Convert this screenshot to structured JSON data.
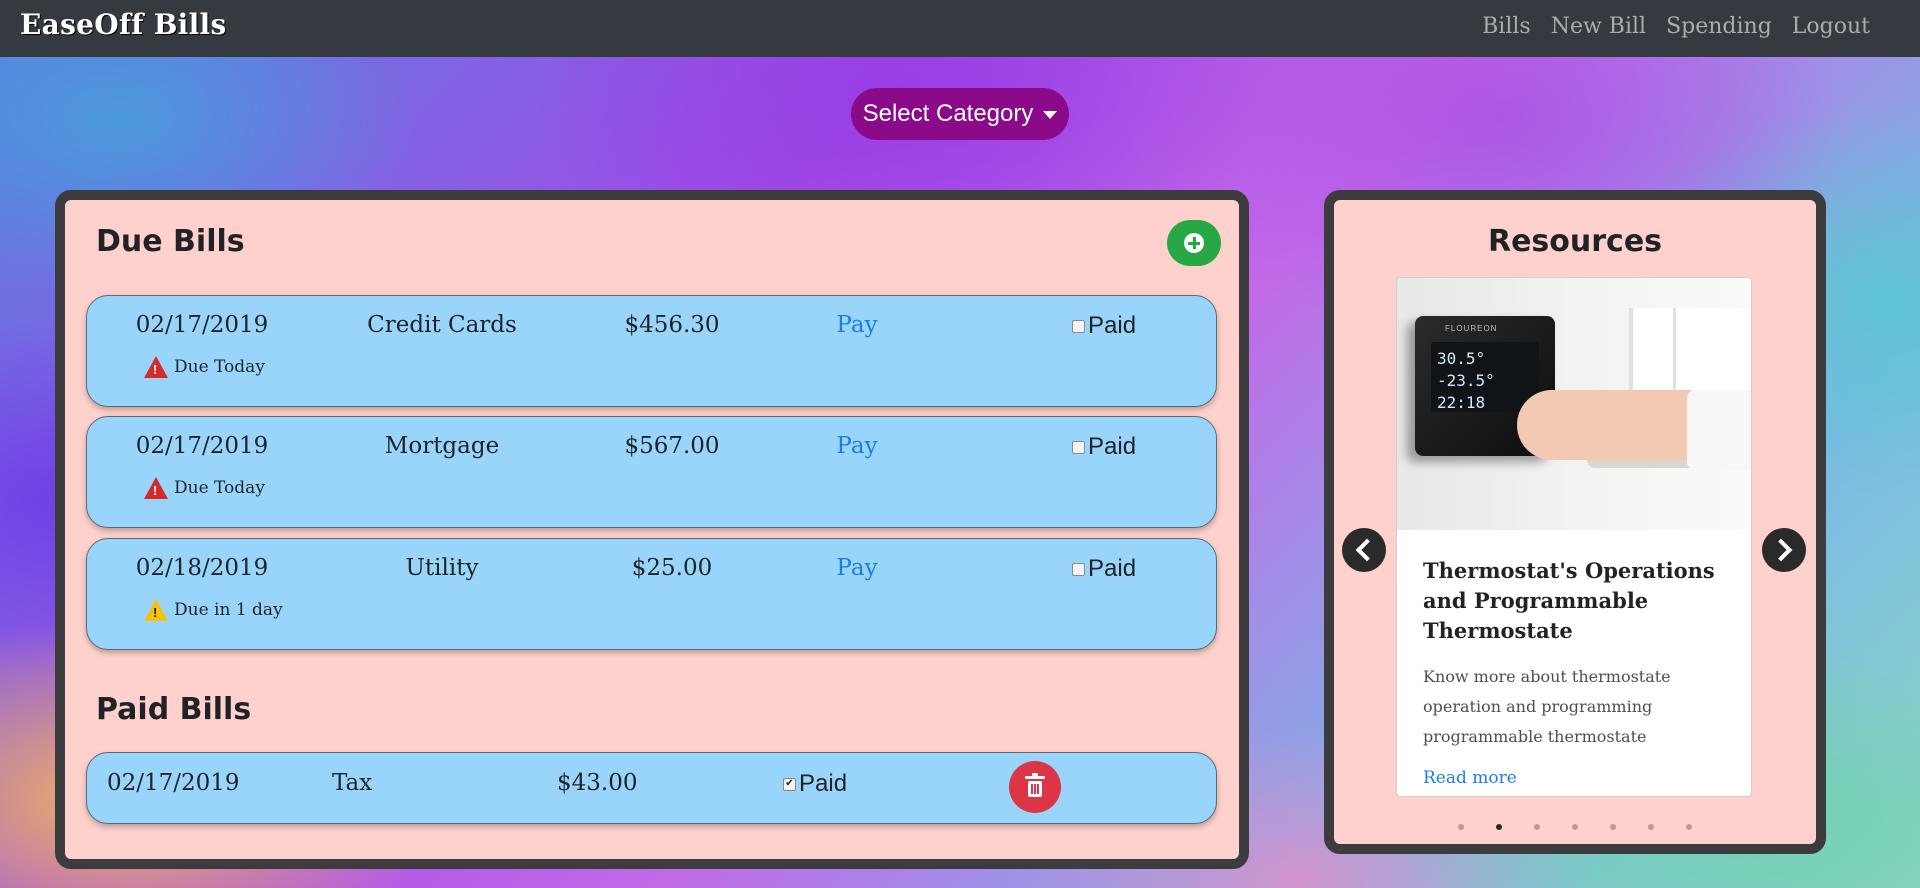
{
  "navbar": {
    "brand": "EaseOff Bills",
    "links": [
      "Bills",
      "New Bill",
      "Spending",
      "Logout"
    ]
  },
  "category_button": {
    "label": "Select Category"
  },
  "due_section": {
    "title": "Due Bills",
    "bills": [
      {
        "date": "02/17/2019",
        "category": "Credit Cards",
        "amount": "$456.30",
        "pay": "Pay",
        "paid_label": "Paid",
        "paid_checked": false,
        "status": "Due Today",
        "status_level": "red"
      },
      {
        "date": "02/17/2019",
        "category": "Mortgage",
        "amount": "$567.00",
        "pay": "Pay",
        "paid_label": "Paid",
        "paid_checked": false,
        "status": "Due Today",
        "status_level": "red"
      },
      {
        "date": "02/18/2019",
        "category": "Utility",
        "amount": "$25.00",
        "pay": "Pay",
        "paid_label": "Paid",
        "paid_checked": false,
        "status": "Due in 1 day",
        "status_level": "yellow"
      }
    ]
  },
  "paid_section": {
    "title": "Paid Bills",
    "bills": [
      {
        "date": "02/17/2019",
        "category": "Tax",
        "amount": "$43.00",
        "paid_label": "Paid",
        "paid_checked": true
      }
    ]
  },
  "resources": {
    "title": "Resources",
    "card": {
      "heading": "Thermostat's Operations and Programmable Thermostate",
      "text": "Know more about thermostate operation and programming programmable thermostate",
      "link": "Read more",
      "image_screen_text": [
        "30.5°  -23.5°",
        "22:18"
      ],
      "image_brand": "FLOUREON"
    },
    "slide_count": 7,
    "active_slide": 1
  },
  "colors": {
    "navbar": "#343a40",
    "category_button": "#8a0a8a",
    "panel": "#ffd1cc",
    "card": "#99d5fb",
    "link": "#1a7fe0",
    "add_button": "#28a745",
    "delete_button": "#dc3545"
  },
  "icons": {
    "add": "plus-circle-icon",
    "delete": "trash-icon",
    "warning": "warning-triangle-icon",
    "prev": "chevron-left-icon",
    "next": "chevron-right-icon"
  }
}
